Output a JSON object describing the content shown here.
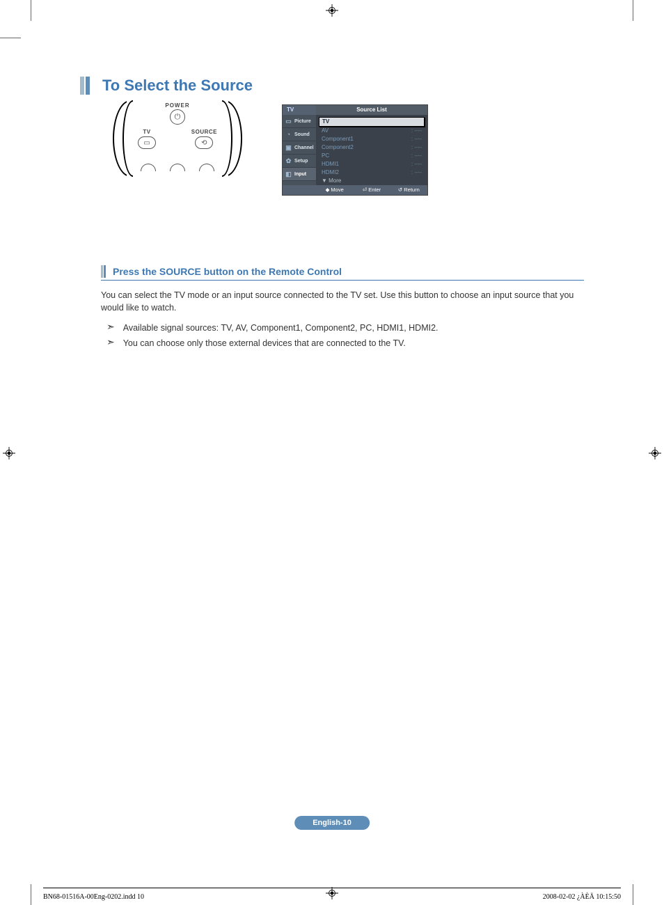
{
  "heading_main": "To Select the Source",
  "remote": {
    "power_label": "POWER",
    "tv_label": "TV",
    "source_label": "SOURCE"
  },
  "osd": {
    "header_tv": "TV",
    "header_title": "Source List",
    "sidebar": [
      {
        "icon": "▭",
        "label": "Picture"
      },
      {
        "icon": "◔",
        "label": "Sound"
      },
      {
        "icon": "▣",
        "label": "Channel"
      },
      {
        "icon": "✿",
        "label": "Setup"
      },
      {
        "icon": "◧",
        "label": "Input"
      }
    ],
    "rows": [
      {
        "label": "TV",
        "val": "",
        "selected": true
      },
      {
        "label": "AV",
        "val": ": ----"
      },
      {
        "label": "Component1",
        "val": ": ----"
      },
      {
        "label": "Component2",
        "val": ": ----"
      },
      {
        "label": "PC",
        "val": ": ----"
      },
      {
        "label": "HDMI1",
        "val": ": ----"
      },
      {
        "label": "HDMI2",
        "val": ": ----"
      }
    ],
    "more": "▼ More",
    "footer": {
      "move": "Move",
      "enter": "Enter",
      "return": "Return"
    }
  },
  "sub_heading": "Press the SOURCE button on the Remote Control",
  "body_text": "You can select the TV mode or an input source connected to the TV set. Use this button to choose an input source that you would like to watch.",
  "bullets": [
    "Available signal sources: TV, AV, Component1, Component2, PC, HDMI1, HDMI2.",
    "You can choose only those external devices that are connected to the TV."
  ],
  "page_pill": "English-10",
  "footer_left": "BN68-01516A-00Eng-0202.indd   10",
  "footer_right": "2008-02-02   ¿ÀÈÄ 10:15:50"
}
